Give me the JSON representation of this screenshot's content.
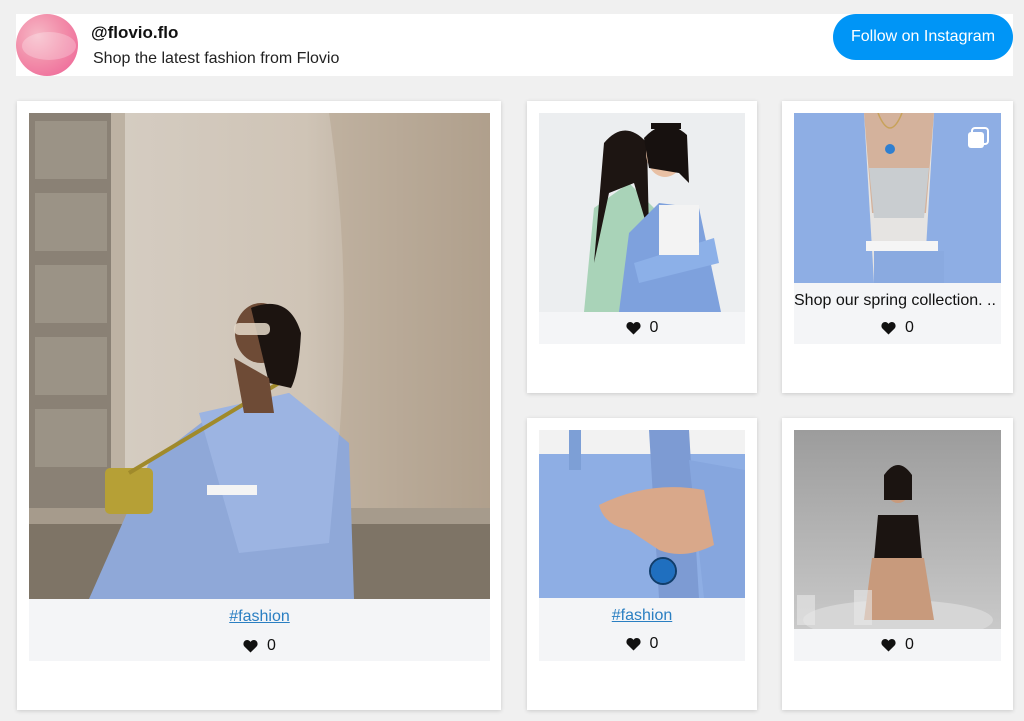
{
  "profile": {
    "handle": "@flovio.flo",
    "tagline": "Shop the latest fashion from Flovio",
    "follow_label": "Follow on Instagram"
  },
  "colors": {
    "follow_button": "#0095f6",
    "hashtag_link": "#2a7fc2",
    "footer_bg": "#f4f5f7",
    "page_bg": "#f0f0f0"
  },
  "posts": [
    {
      "hashtag": "#fashion",
      "likes": "0",
      "image": "woman in blue suit reclining against stone wall"
    },
    {
      "likes": "0",
      "image": "two women in blue suits embracing"
    },
    {
      "caption": "Shop our spring collection. ...",
      "likes": "0",
      "image": "blue suit with crop top and necklace",
      "icon": "multiple-images-icon"
    },
    {
      "hashtag": "#fashion",
      "likes": "0",
      "image": "hand with blue ring in trouser pocket"
    },
    {
      "likes": "0",
      "image": "woman seated on floor in grey studio"
    }
  ]
}
